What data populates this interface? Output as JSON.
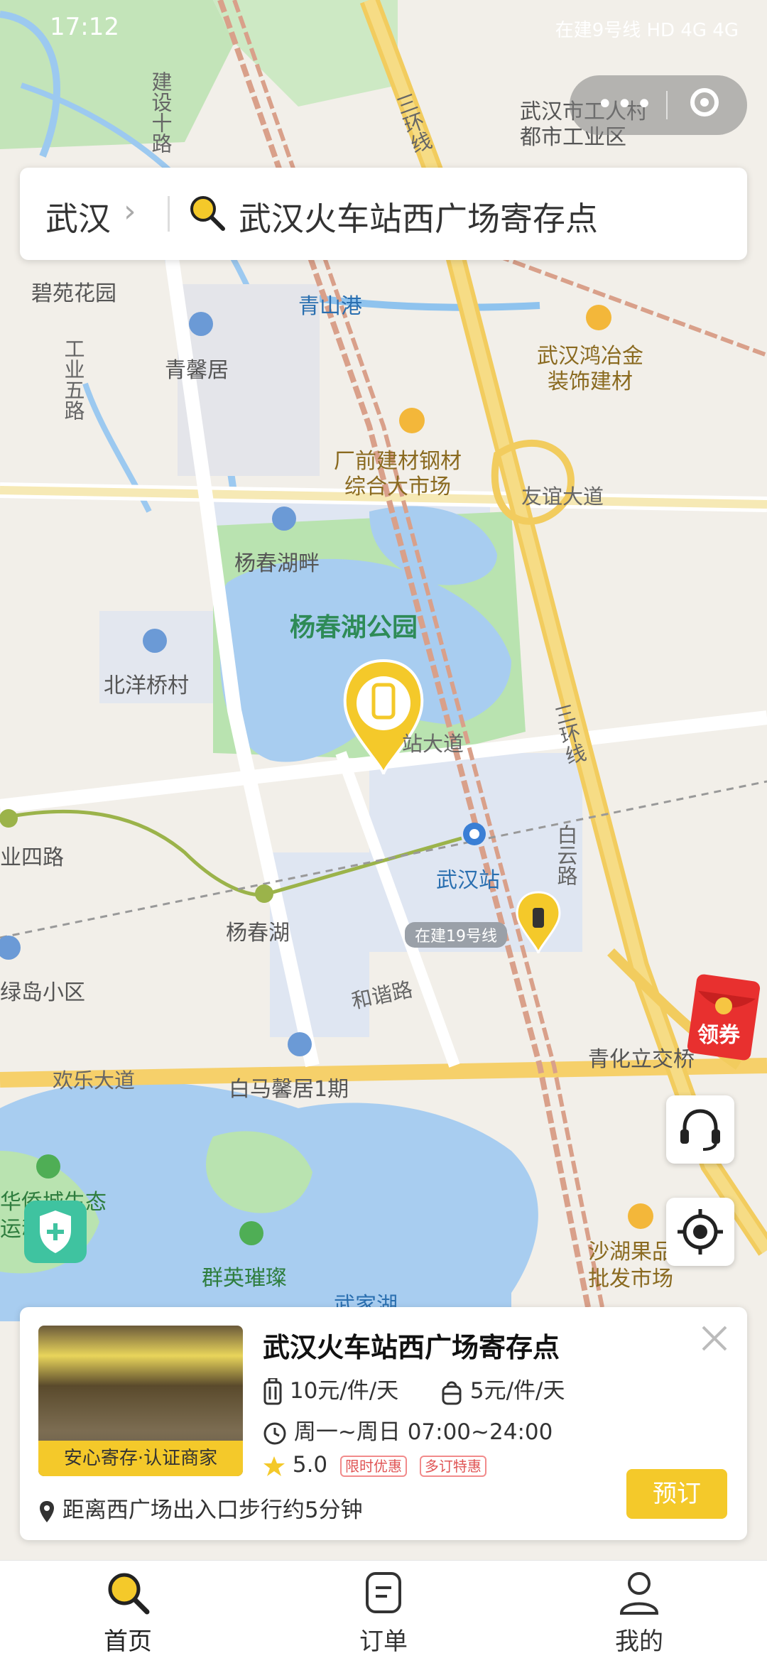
{
  "status_bar": {
    "time": "17:12",
    "indicators": "在建9号线 HD 4G 4G"
  },
  "search": {
    "city": "武汉",
    "query": "武汉火车站西广场寄存点"
  },
  "map": {
    "labels": {
      "gongren": "武汉市工人村\n都市工业区",
      "sanhuan1": "三环线",
      "jianshe": "建设十路",
      "biyuan": "碧苑花园",
      "qingshangang": "青山港",
      "qingxin": "青馨居",
      "gongye5": "工业五路",
      "hongye": "武汉鸿冶金\n装饰建材",
      "guangqian": "厂前建材钢材\n综合大市场",
      "youyi": "友谊大道",
      "yangchunpan": "杨春湖畔",
      "park": "杨春湖公园",
      "beiyang": "北洋桥村",
      "dadao": "站大道",
      "sanhuan2": "三环线",
      "sipu": "业四路",
      "wuhanzhan": "武汉站",
      "baiyun": "白云路",
      "yangchunhu": "杨春湖",
      "line19": "在建19号线",
      "lvdao": "绿岛小区",
      "hexie": "和谐路",
      "qinghua": "青化立交桥",
      "huanle": "欢乐大道",
      "baima": "白马馨居1期",
      "huaqiao": "华侨城生态\n运动公园",
      "qunying": "群英璀璨",
      "shahu": "沙湖果品\n批发市场",
      "wujiahu": "武家湖"
    },
    "colors": {
      "water": "#a8cdf0",
      "park": "#b9e3b0",
      "ring_road": "#f2d36b",
      "rail": "#d9a08a",
      "metro": "#9bb34a"
    }
  },
  "coupon": {
    "label": "领券"
  },
  "card": {
    "title": "武汉火车站西广场寄存点",
    "badge": "安心寄存·认证商家",
    "price_large": "10元/件/天",
    "price_small": "5元/件/天",
    "hours": "周一~周日 07:00~24:00",
    "rating": "5.0",
    "tags": [
      "限时优惠",
      "多订特惠"
    ],
    "distance": "距离西广场出入口步行约5分钟",
    "book_label": "预订"
  },
  "nav": {
    "items": [
      {
        "label": "首页",
        "icon": "search-icon"
      },
      {
        "label": "订单",
        "icon": "orders-icon"
      },
      {
        "label": "我的",
        "icon": "profile-icon"
      }
    ]
  }
}
